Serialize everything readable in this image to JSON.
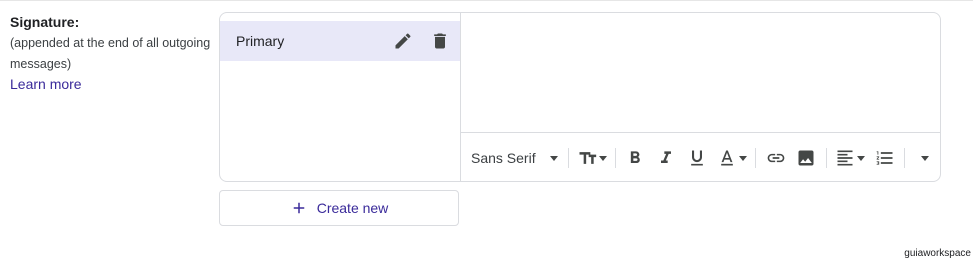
{
  "signature_setting": {
    "title": "Signature:",
    "description": "(appended at the end of all outgoing messages)",
    "learn_more": "Learn more"
  },
  "signatures": [
    {
      "label": "Primary",
      "selected": true
    }
  ],
  "toolbar": {
    "font_family": "Sans Serif",
    "buttons": [
      "text-size-icon",
      "bold-icon",
      "italic-icon",
      "underline-icon",
      "text-color-icon",
      "link-icon",
      "image-icon",
      "align-icon",
      "numbered-list-icon",
      "more-options-icon"
    ]
  },
  "create_new": "Create new",
  "watermark": "guiaworkspace",
  "colors": {
    "accent": "#3a2a9a",
    "selected_row": "#e8e8f8",
    "border": "#dadce0"
  }
}
